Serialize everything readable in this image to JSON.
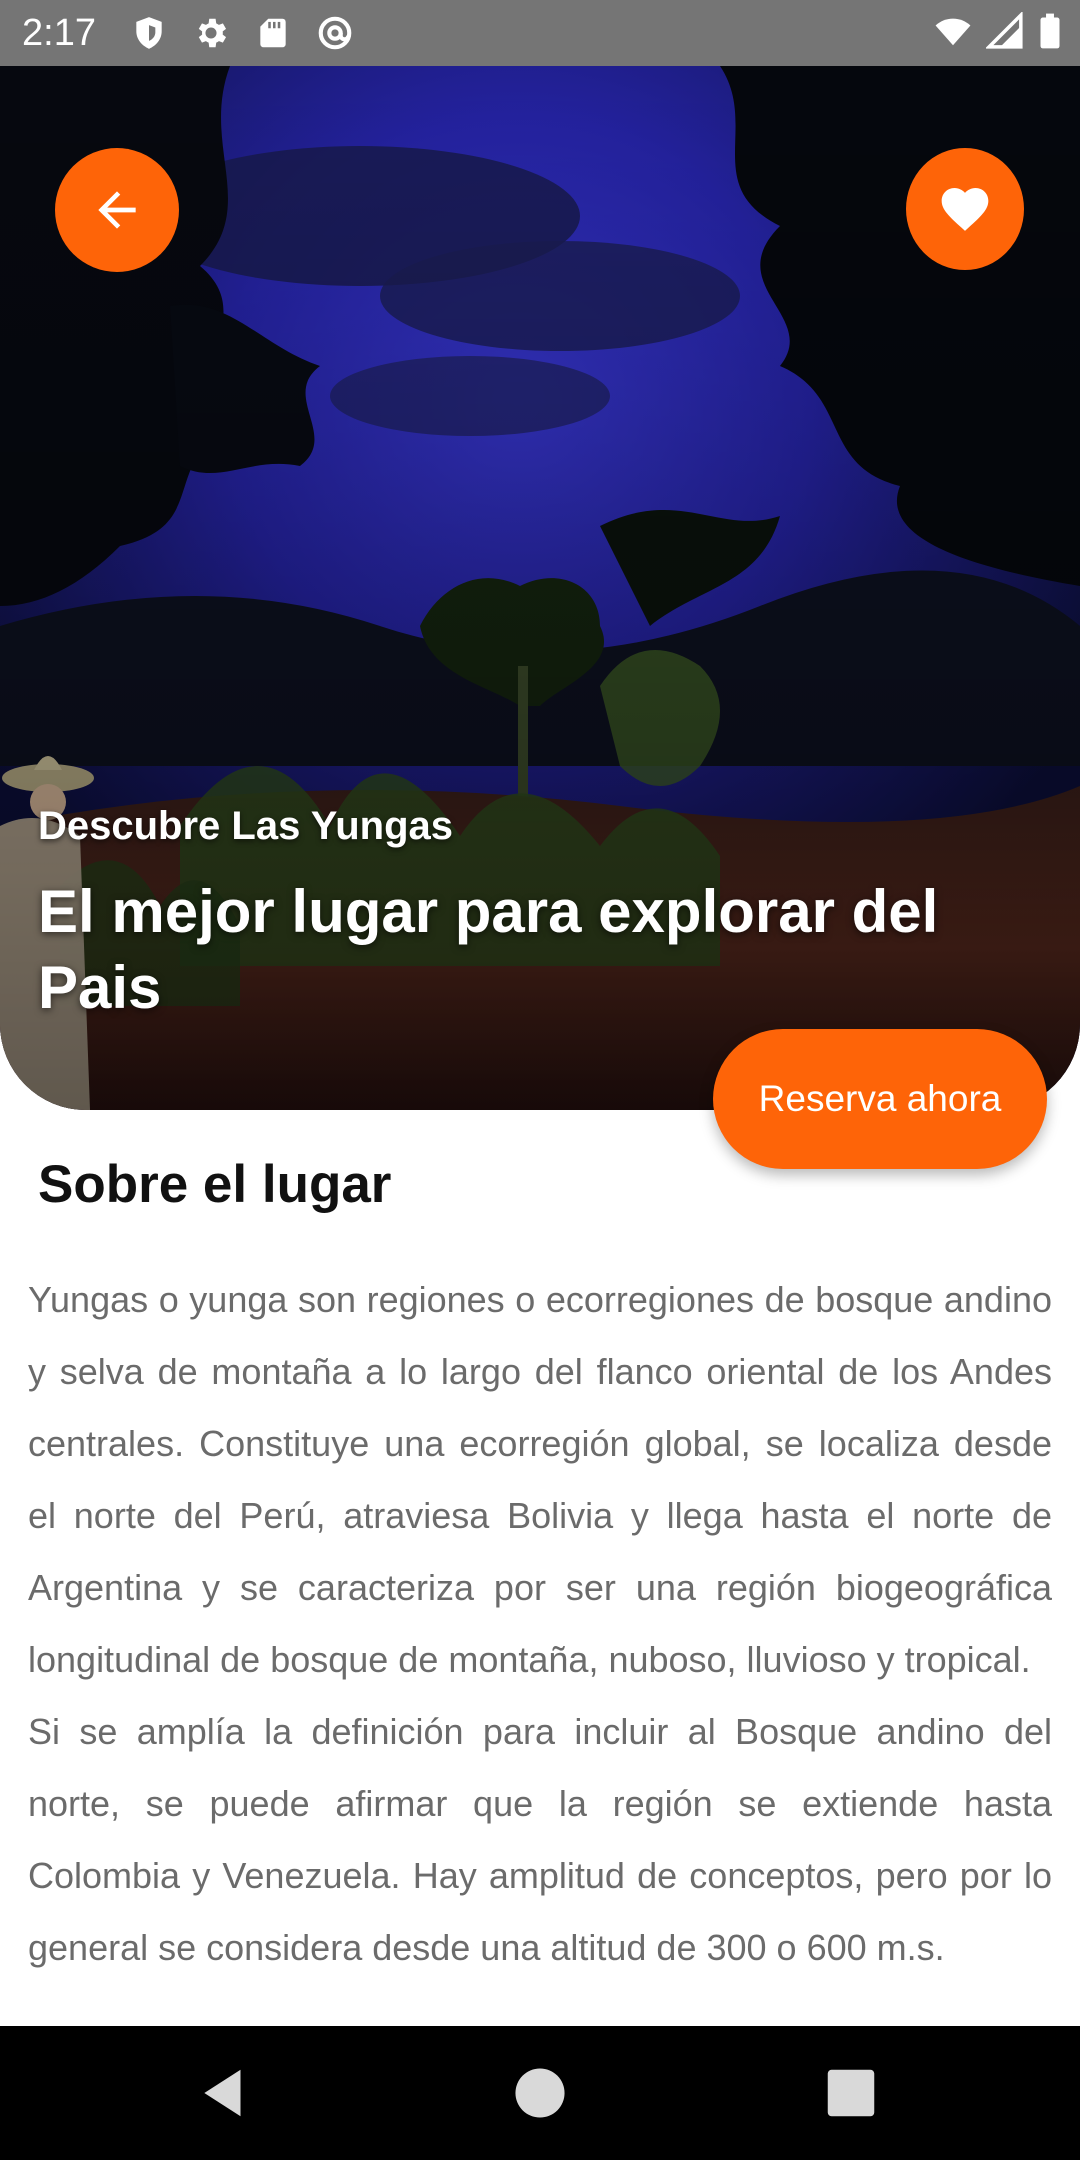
{
  "status_bar": {
    "time": "2:17",
    "left_icons": [
      "shield-icon",
      "settings-gear-icon",
      "sd-card-icon",
      "at-sign-icon"
    ],
    "right_icons": [
      "wifi-icon",
      "cellular-signal-icon",
      "battery-icon"
    ]
  },
  "hero": {
    "image": "night-jungle-landscape-with-person",
    "subtitle": "Descubre Las Yungas",
    "title": "El mejor lugar para explorar del Pais"
  },
  "actions": {
    "back_icon": "arrow-left-icon",
    "favorite_icon": "heart-icon",
    "reserve_label": "Reserva ahora"
  },
  "about": {
    "heading": "Sobre el lugar",
    "paragraph_1": "Yungas o yunga son regiones o ecorregiones de bosque andino y selva de montaña a lo largo del flanco oriental de los Andes centrales. Constituye una ecorregión global, se localiza desde el norte del Perú, atraviesa Bolivia y llega hasta el norte de Argentina y se caracteriza por ser una región biogeográfica longitudinal de bosque de montaña, nuboso, lluvioso y tropical.",
    "paragraph_2": "Si se amplía la definición para incluir al Bosque andino del norte, se puede afirmar que la región se extiende hasta Colombia y Venezuela. Hay amplitud de conceptos, pero por lo general se considera desde una altitud de 300 o 600 m.s."
  },
  "nav_bar": {
    "buttons": [
      "back-triangle-icon",
      "home-circle-icon",
      "recents-square-icon"
    ]
  },
  "colors": {
    "accent": "#fe6408",
    "status_bar": "#757575",
    "body_text": "#6b6b6b",
    "heading_text": "#111111",
    "nav_bar": "#000000"
  }
}
